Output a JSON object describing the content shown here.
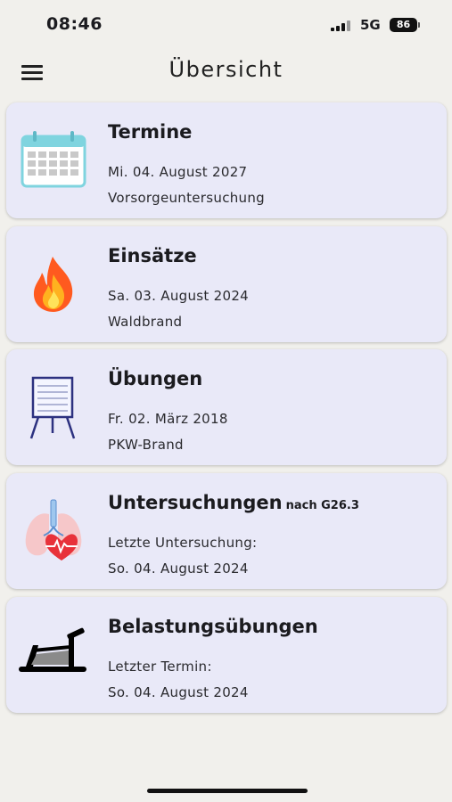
{
  "status_bar": {
    "time": "08:46",
    "network": "5G",
    "battery": "86"
  },
  "app_bar": {
    "title": "Übersicht",
    "menu_icon": "hamburger-menu-icon"
  },
  "cards": [
    {
      "title": "Termine",
      "line1": "Mi. 04. August 2027",
      "line2": "Vorsorgeuntersuchung",
      "icon": "calendar-icon"
    },
    {
      "title": "Einsätze",
      "line1": "Sa. 03. August 2024",
      "line2": "Waldbrand",
      "icon": "fire-icon"
    },
    {
      "title": "Übungen",
      "line1": "Fr. 02. März 2018",
      "line2": "PKW-Brand",
      "icon": "flipchart-icon"
    },
    {
      "title": "Untersuchungen",
      "title_suffix": "nach G26.3",
      "line1": "Letzte Untersuchung:",
      "line2": "So. 04. August 2024",
      "icon": "lungs-heart-icon"
    },
    {
      "title": "Belastungsübungen",
      "line1": "Letzter Termin:",
      "line2": "So. 04. August 2024",
      "icon": "treadmill-icon"
    }
  ],
  "colors": {
    "background": "#f1f0ec",
    "card": "#e9e9f8",
    "text": "#1b1b1f"
  }
}
